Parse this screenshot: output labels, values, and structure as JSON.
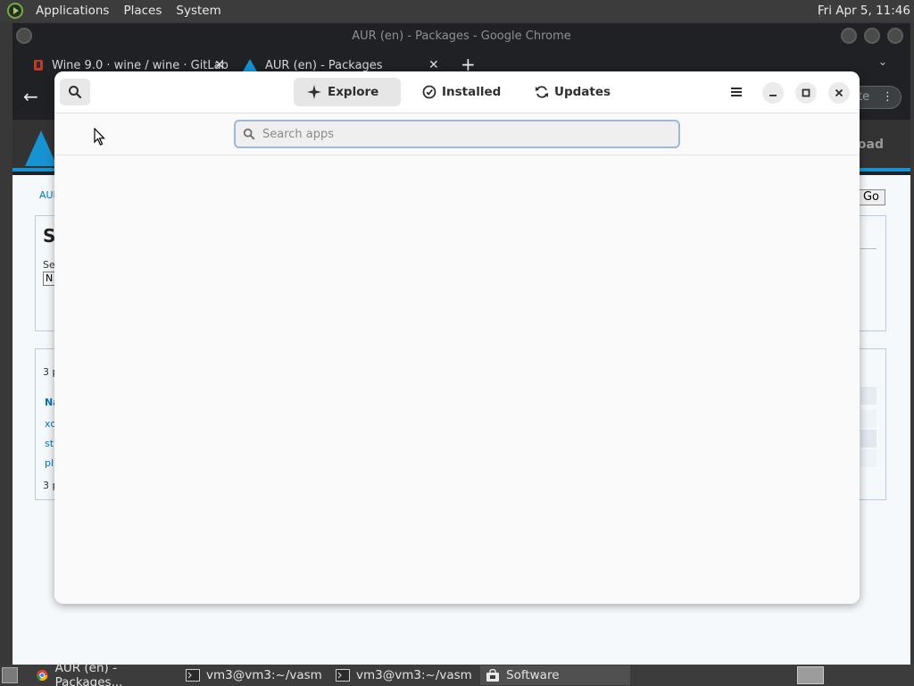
{
  "top_panel": {
    "menus": [
      "Applications",
      "Places",
      "System"
    ],
    "clock": "Fri Apr 5, 11:46"
  },
  "chrome": {
    "window_title": "AUR (en) - Packages - Google Chrome",
    "tabs": [
      {
        "label": "Wine 9.0 · wine / wine · GitLab",
        "icon": "gitlab-icon"
      },
      {
        "label": "AUR (en) - Packages",
        "icon": "arch-linux-icon"
      }
    ],
    "update_label": "ate"
  },
  "aur_page": {
    "download_label": "oad",
    "crumb": "AUI",
    "go_label": "Go",
    "heading": "S",
    "search_label": "Se",
    "select_value": "N",
    "count_top": "3 p",
    "col_header": "Na",
    "rows": [
      "xc",
      "st",
      "pl"
    ],
    "count_bottom": "3 p"
  },
  "software": {
    "tabs": [
      {
        "label": "Explore",
        "icon": "explore-sparkle-icon",
        "active": true
      },
      {
        "label": "Installed",
        "icon": "check-circle-icon",
        "active": false
      },
      {
        "label": "Updates",
        "icon": "refresh-icon",
        "active": false
      }
    ],
    "search": {
      "placeholder": "Search apps",
      "value": ""
    }
  },
  "taskbar": {
    "items": [
      {
        "label": "AUR (en) - Packages...",
        "icon": "chrome-icon",
        "active": false
      },
      {
        "label": "vm3@vm3:~/vasm",
        "icon": "terminal-icon",
        "active": false
      },
      {
        "label": "vm3@vm3:~/vasm",
        "icon": "terminal-icon",
        "active": false
      },
      {
        "label": "Software",
        "icon": "software-bag-icon",
        "active": true
      }
    ]
  },
  "colors": {
    "aur_blue": "#1793d1",
    "panel_bg": "#3c3c3c",
    "dialog_bg": "#fafafa"
  }
}
